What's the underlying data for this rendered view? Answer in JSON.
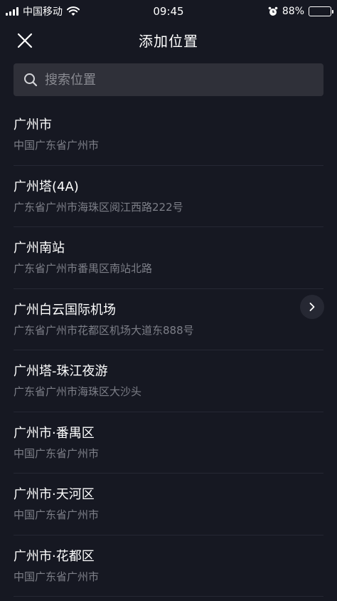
{
  "status_bar": {
    "carrier": "中国移动",
    "time": "09:45",
    "battery_percent": "88%",
    "battery_level": 0.88
  },
  "header": {
    "title": "添加位置",
    "close_icon": "close-icon"
  },
  "search": {
    "placeholder": "搜索位置",
    "value": ""
  },
  "locations": [
    {
      "name": "广州市",
      "address": "中国广东省广州市"
    },
    {
      "name": "广州塔(4A)",
      "address": "广东省广州市海珠区阅江西路222号"
    },
    {
      "name": "广州南站",
      "address": "广东省广州市番禺区南站北路"
    },
    {
      "name": "广州白云国际机场",
      "address": "广东省广州市花都区机场大道东888号"
    },
    {
      "name": "广州塔-珠江夜游",
      "address": "广东省广州市海珠区大沙头"
    },
    {
      "name": "广州市·番禺区",
      "address": "中国广东省广州市"
    },
    {
      "name": "广州市·天河区",
      "address": "中国广东省广州市"
    },
    {
      "name": "广州市·花都区",
      "address": "中国广东省广州市"
    }
  ],
  "colors": {
    "background": "#161822",
    "search_bg": "#2f3039",
    "secondary_text": "#7d7f88",
    "divider": "#262834"
  }
}
